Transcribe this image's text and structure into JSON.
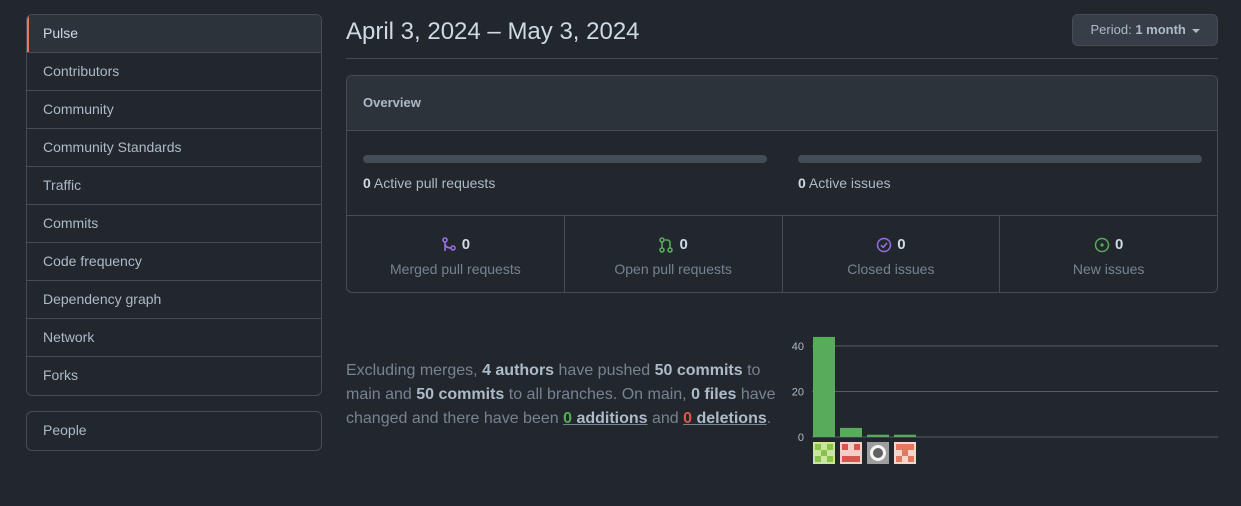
{
  "sidebar": {
    "items": [
      {
        "label": "Pulse"
      },
      {
        "label": "Contributors"
      },
      {
        "label": "Community"
      },
      {
        "label": "Community Standards"
      },
      {
        "label": "Traffic"
      },
      {
        "label": "Commits"
      },
      {
        "label": "Code frequency"
      },
      {
        "label": "Dependency graph"
      },
      {
        "label": "Network"
      },
      {
        "label": "Forks"
      }
    ],
    "people_label": "People",
    "selected_color": "#ec775c"
  },
  "header": {
    "date_range": "April 3, 2024 – May 3, 2024",
    "period_prefix": "Period:",
    "period_value": "1 month"
  },
  "overview": {
    "title": "Overview",
    "active_prs_count": "0",
    "active_prs_label": "Active pull requests",
    "active_issues_count": "0",
    "active_issues_label": "Active issues",
    "stats": [
      {
        "count": "0",
        "label": "Merged pull requests",
        "icon": "merged-pr-icon",
        "color": "#986ee2"
      },
      {
        "count": "0",
        "label": "Open pull requests",
        "icon": "open-pr-icon",
        "color": "#57ab5a"
      },
      {
        "count": "0",
        "label": "Closed issues",
        "icon": "closed-issue-icon",
        "color": "#986ee2"
      },
      {
        "count": "0",
        "label": "New issues",
        "icon": "new-issue-icon",
        "color": "#57ab5a"
      }
    ]
  },
  "summary": {
    "t1": "Excluding merges, ",
    "authors": "4 authors",
    "t2": " have pushed ",
    "commits_main": "50 commits",
    "t3": " to main and ",
    "commits_all": "50 commits",
    "t4": " to all branches. On main, ",
    "files": "0 files",
    "t5": " have changed and there have been ",
    "additions_num": "0",
    "additions_word": "additions",
    "t6": " and ",
    "deletions_num": "0",
    "deletions_word": "deletions",
    "t7": "."
  },
  "chart_data": {
    "type": "bar",
    "categories": [
      "contributor-1",
      "contributor-2",
      "contributor-3",
      "contributor-4"
    ],
    "values": [
      44,
      4,
      1,
      1
    ],
    "ylim": [
      0,
      46
    ],
    "yticks": [
      "0",
      "20",
      "40"
    ],
    "bar_color": "#57ab5a",
    "grid": true
  }
}
